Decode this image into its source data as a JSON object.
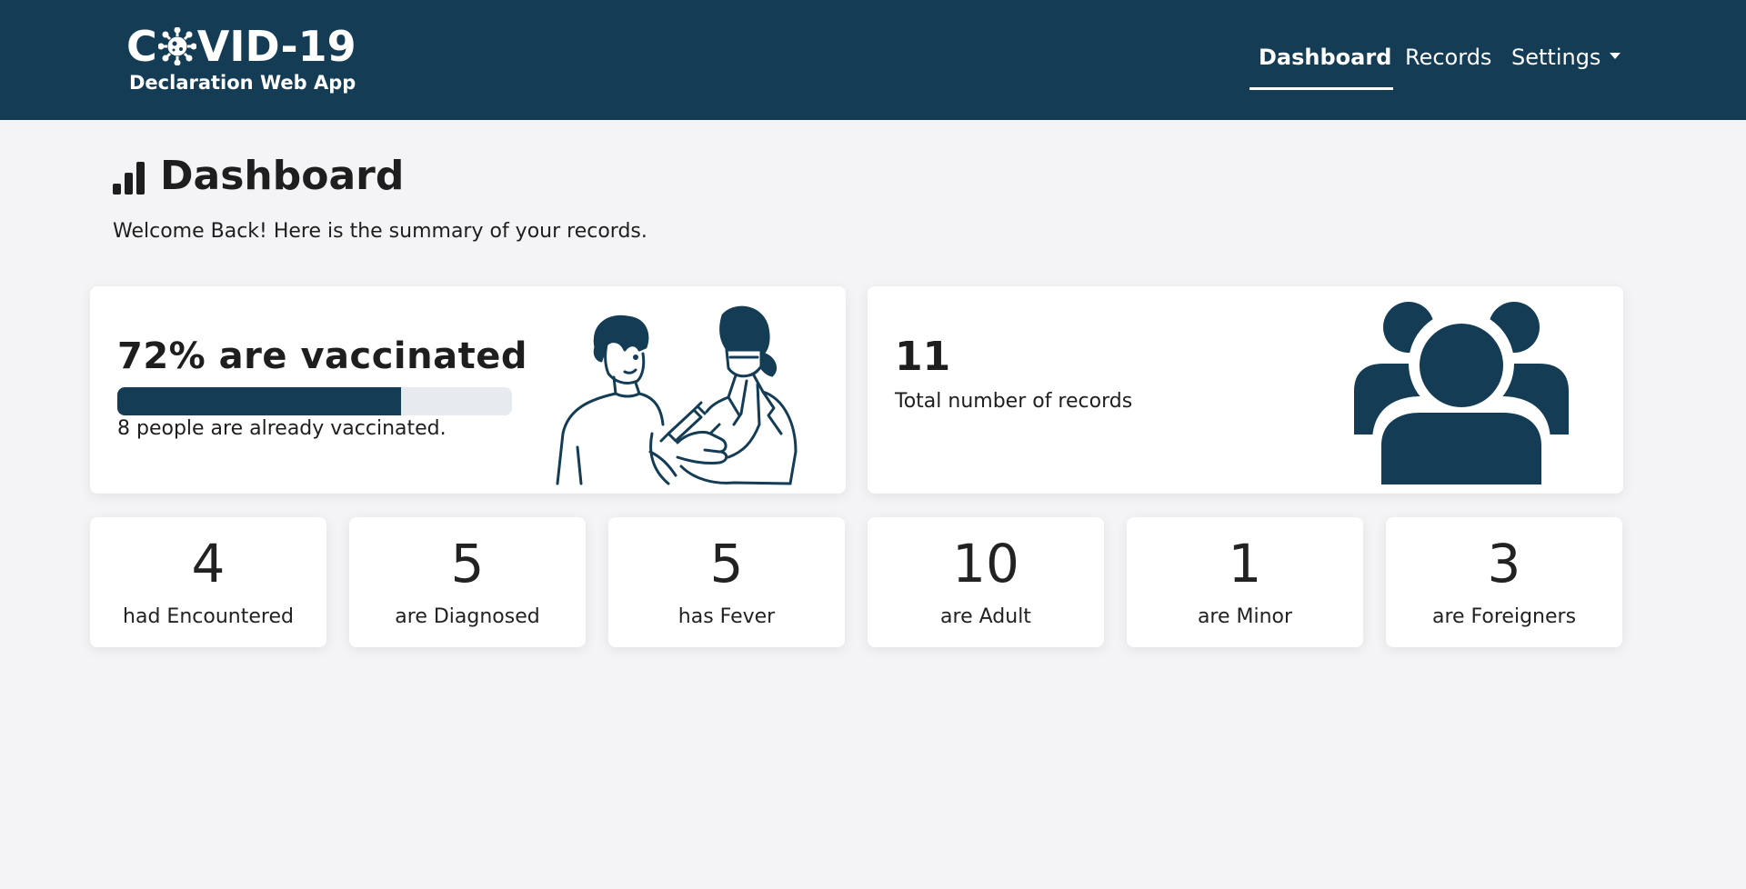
{
  "brand": {
    "title_before": "C",
    "title_after": "VID-19",
    "subtitle": "Declaration Web App",
    "icon": "virus-icon"
  },
  "nav": {
    "dashboard": "Dashboard",
    "records": "Records",
    "settings": "Settings"
  },
  "page": {
    "title": "Dashboard",
    "subtitle": "Welcome Back! Here is the summary of your records.",
    "icon": "bar-chart-icon"
  },
  "vaccination": {
    "title": "72% are vaccinated",
    "percent": 72,
    "subtitle": "8 people are already vaccinated.",
    "illustration": "vaccination-illustration"
  },
  "records": {
    "total": "11",
    "label": "Total number of records",
    "icon": "users-icon"
  },
  "stats": [
    {
      "value": "4",
      "label": "had Encountered"
    },
    {
      "value": "5",
      "label": "are Diagnosed"
    },
    {
      "value": "5",
      "label": "has Fever"
    },
    {
      "value": "10",
      "label": "are Adult"
    },
    {
      "value": "1",
      "label": "are Minor"
    },
    {
      "value": "3",
      "label": "are Foreigners"
    }
  ],
  "colors": {
    "brand": "#143c55",
    "background": "#f4f4f6",
    "card": "#ffffff"
  }
}
